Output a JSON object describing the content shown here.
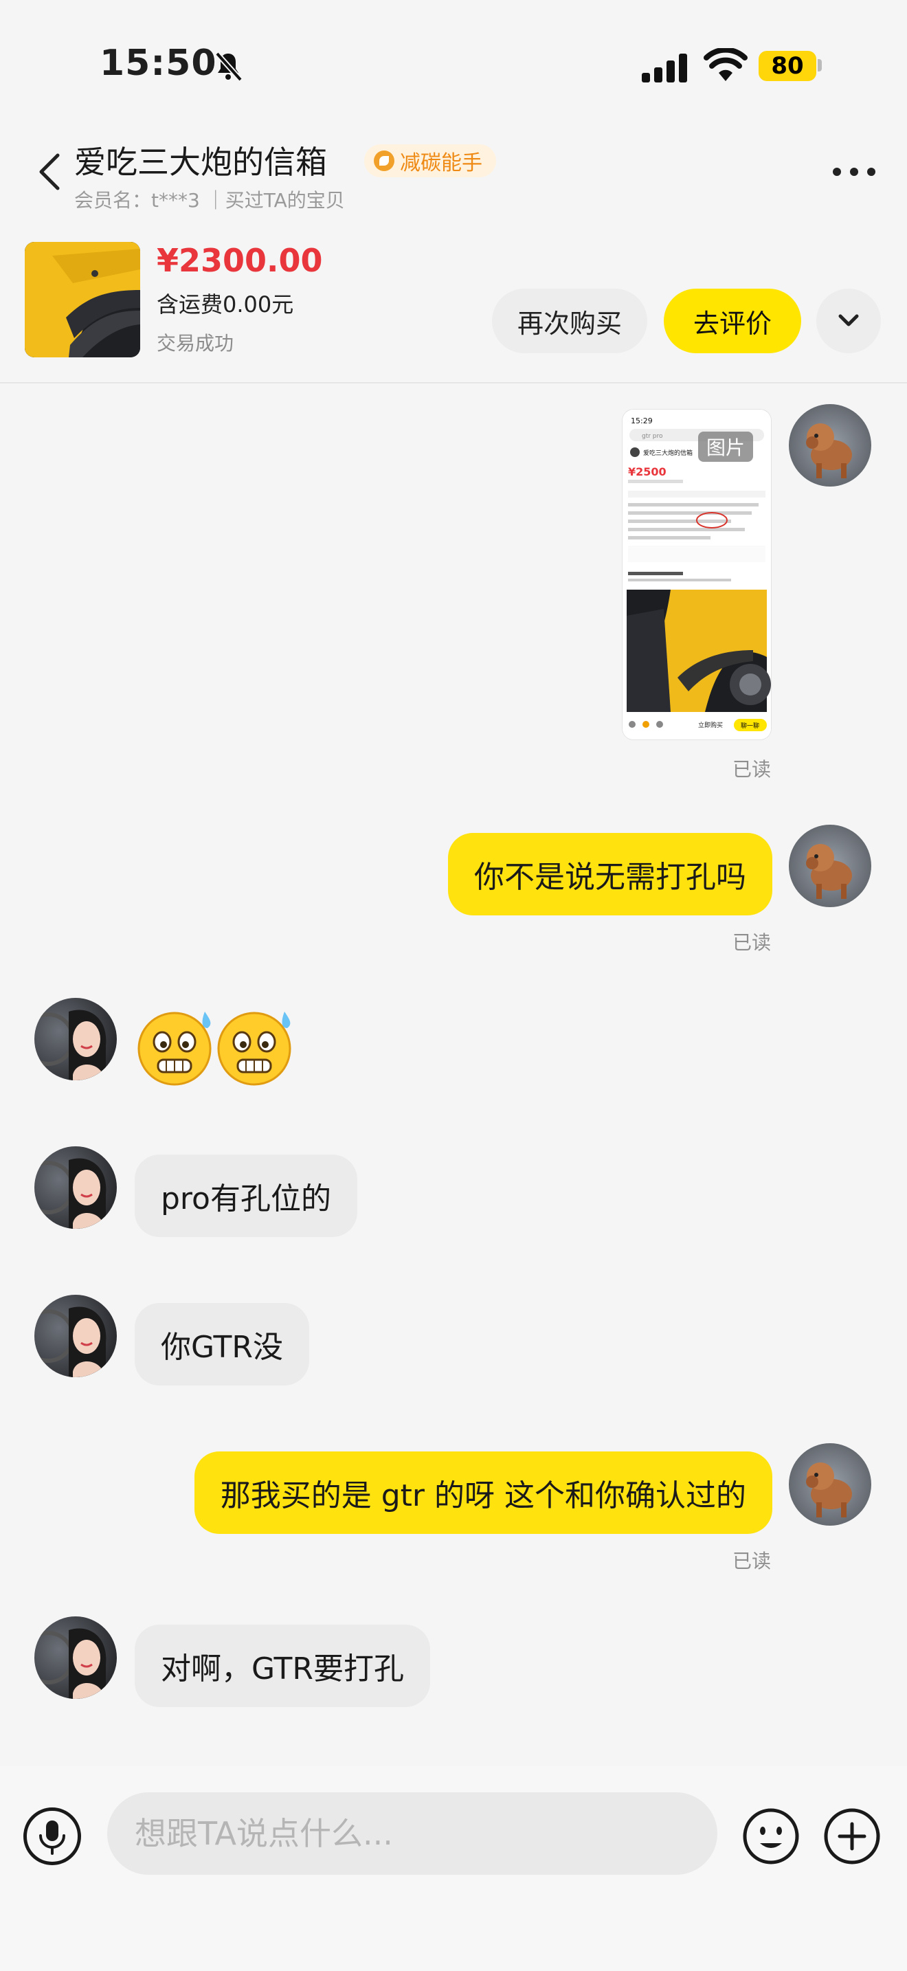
{
  "status_bar": {
    "time": "15:50",
    "battery": "80"
  },
  "header": {
    "seller_name": "爱吃三大炮的信箱",
    "badge": "减碳能手",
    "member_line": "会员名：t***3 ｜买过TA的宝贝"
  },
  "product": {
    "price": "¥2300.00",
    "shipping": "含运费0.00元",
    "status": "交易成功",
    "rebuy_label": "再次购买",
    "review_label": "去评价"
  },
  "screenshot_card": {
    "tag": "图片",
    "time": "15:29",
    "search": "gtr pro",
    "price": "¥2500",
    "seller": "爱吃三大炮的信箱",
    "buy_label": "立即购买",
    "chat_label": "聊一聊"
  },
  "messages": {
    "m2": "你不是说无需打孔吗",
    "m4": "pro有孔位的",
    "m5": "你GTR没",
    "m6": "那我买的是 gtr 的呀 这个和你确认过的",
    "m7": "对啊，GTR要打孔",
    "read": "已读"
  },
  "input": {
    "placeholder": "想跟TA说点什么..."
  },
  "colors": {
    "accent": "#ffe20e",
    "price": "#e8363c",
    "badge": "#ee8a14"
  }
}
